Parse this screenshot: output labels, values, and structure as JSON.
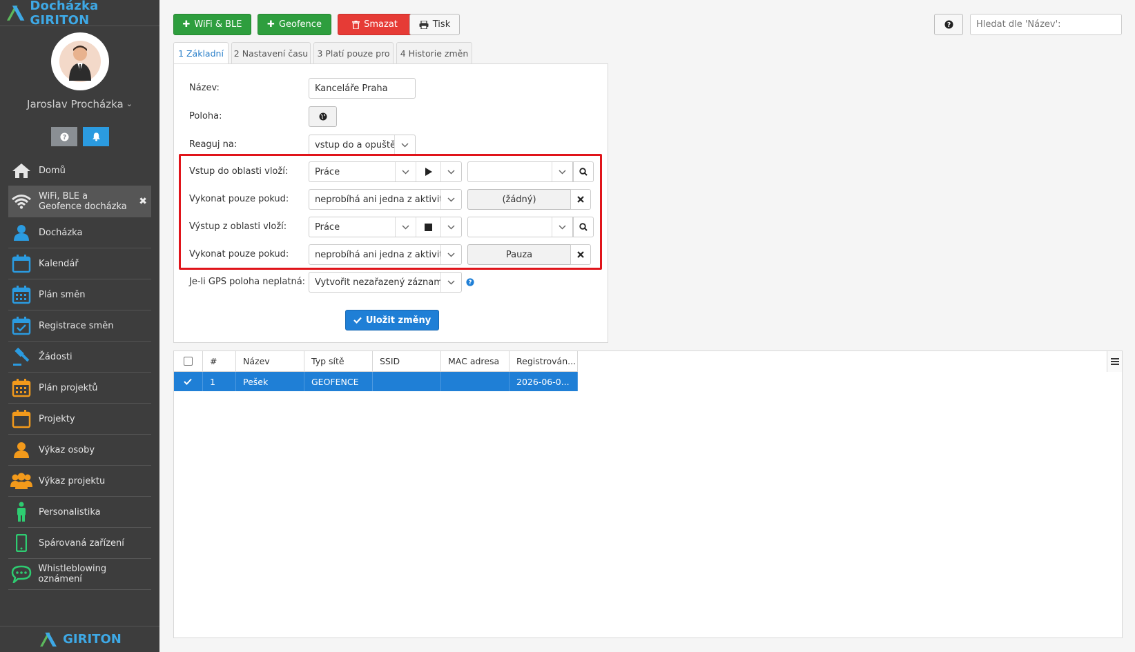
{
  "app": {
    "title": "Docházka GIRITON",
    "footer": "GIRITON"
  },
  "user": {
    "name": "Jaroslav Procházka"
  },
  "nav": [
    {
      "label": "Domů",
      "icon": "home-icon"
    },
    {
      "label": "WiFi, BLE a Geofence docházka",
      "icon": "wifi-icon",
      "active": true
    },
    {
      "label": "Docházka",
      "icon": "person-icon"
    },
    {
      "label": "Kalendář",
      "icon": "calendar-icon"
    },
    {
      "label": "Plán směn",
      "icon": "calendar-grid-icon"
    },
    {
      "label": "Registrace směn",
      "icon": "calendar-check-icon"
    },
    {
      "label": "Žádosti",
      "icon": "gavel-icon"
    },
    {
      "label": "Plán projektů",
      "icon": "calendar-grid-icon"
    },
    {
      "label": "Projekty",
      "icon": "calendar-icon"
    },
    {
      "label": "Výkaz osoby",
      "icon": "person-icon"
    },
    {
      "label": "Výkaz projektu",
      "icon": "group-icon"
    },
    {
      "label": "Personalistika",
      "icon": "standing-person-icon"
    },
    {
      "label": "Spárovaná zařízení",
      "icon": "mobile-icon"
    },
    {
      "label": "Whistleblowing oznámení",
      "icon": "chat-icon"
    }
  ],
  "toolbar": {
    "wifi_ble": "WiFi & BLE",
    "geofence": "Geofence",
    "delete": "Smazat",
    "print": "Tisk",
    "search_placeholder": "Hledat dle 'Název':"
  },
  "tabs": [
    "1 Základní",
    "2 Nastavení času",
    "3 Platí pouze pro",
    "4 Historie změn"
  ],
  "form": {
    "name_label": "Název:",
    "name_value": "Kanceláře Praha",
    "location_label": "Poloha:",
    "react_label": "Reaguj na:",
    "react_value": "vstup do a opuštění",
    "entry_label": "Vstup do oblasti vloží:",
    "entry_value": "Práce",
    "entry_cond_label": "Vykonat pouze pokud:",
    "entry_cond_value": "neprobíhá ani jedna z aktivit",
    "entry_cond_target": "(žádný)",
    "exit_label": "Výstup z oblasti vloží:",
    "exit_value": "Práce",
    "exit_cond_label": "Vykonat pouze pokud:",
    "exit_cond_value": "neprobíhá ani jedna z aktivit",
    "exit_cond_target": "Pauza",
    "gps_label": "Je-li GPS poloha neplatná:",
    "gps_value": "Vytvořit nezařazený záznam",
    "save": "Uložit změny"
  },
  "grid": {
    "columns": [
      "#",
      "Název",
      "Typ sítě",
      "SSID",
      "MAC adresa",
      "Registrován..."
    ],
    "rows": [
      {
        "num": "1",
        "name": "Pešek",
        "type": "GEOFENCE",
        "ssid": "",
        "mac": "",
        "registered": "2026-06-0..."
      }
    ]
  }
}
